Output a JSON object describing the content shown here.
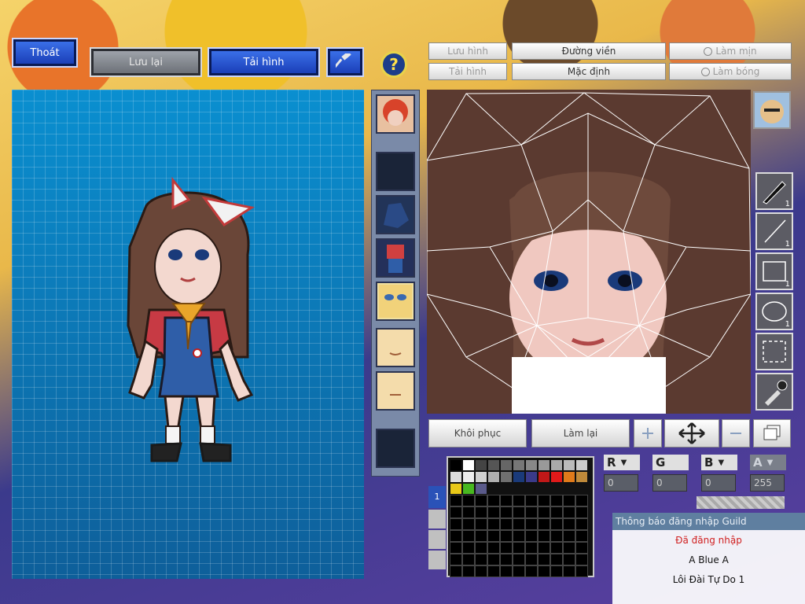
{
  "toolbar": {
    "exit_label": "Thoát",
    "save_label": "Lưu lại",
    "reload_label": "Tải hình",
    "help_symbol": "?"
  },
  "face_toolbar": {
    "save_image": "Lưu hình",
    "border": "Đường viền",
    "smooth": "Làm mịn",
    "load_image": "Tải hình",
    "default": "Mặc định",
    "shine": "Làm bóng"
  },
  "bottom_controls": {
    "restore": "Khôi phục",
    "redo": "Làm lại"
  },
  "tools": [
    {
      "icon": "brush-icon",
      "count": "1"
    },
    {
      "icon": "line-icon",
      "count": "1"
    },
    {
      "icon": "rectangle-icon",
      "count": "1"
    },
    {
      "icon": "ellipse-icon",
      "count": "1"
    },
    {
      "icon": "selection-icon",
      "count": ""
    },
    {
      "icon": "eyedropper-icon",
      "count": ""
    }
  ],
  "color_channels": {
    "r": {
      "label": "R",
      "value": "0"
    },
    "g": {
      "label": "G",
      "value": "0"
    },
    "b": {
      "label": "B",
      "value": "0"
    },
    "a": {
      "label": "A",
      "value": "255"
    }
  },
  "palette_colors": [
    "#000000",
    "#ffffff",
    "#444444",
    "#555555",
    "#666666",
    "#777777",
    "#888888",
    "#999999",
    "#aaaaaa",
    "#bbbbbb",
    "#cccccc",
    "#dddddd",
    "#eeeeee",
    "#d0d0d0",
    "#b0b0b0",
    "#707070",
    "#1a3a7a",
    "#3a3a8a",
    "#c01818",
    "#e01a1a",
    "#e07a1a",
    "#c08a3a",
    "#e8c818",
    "#48b820",
    "#5a5a8a"
  ],
  "palette_tab": "1",
  "notification": {
    "title": "Thông báo đăng nhập Guild",
    "status": "Đã đăng nhập",
    "user": "A Blue A",
    "location": "Lôi Đài Tự Do 1"
  },
  "colors": {
    "grid_bg": "#1a7fb5",
    "status_red": "#d02020"
  }
}
